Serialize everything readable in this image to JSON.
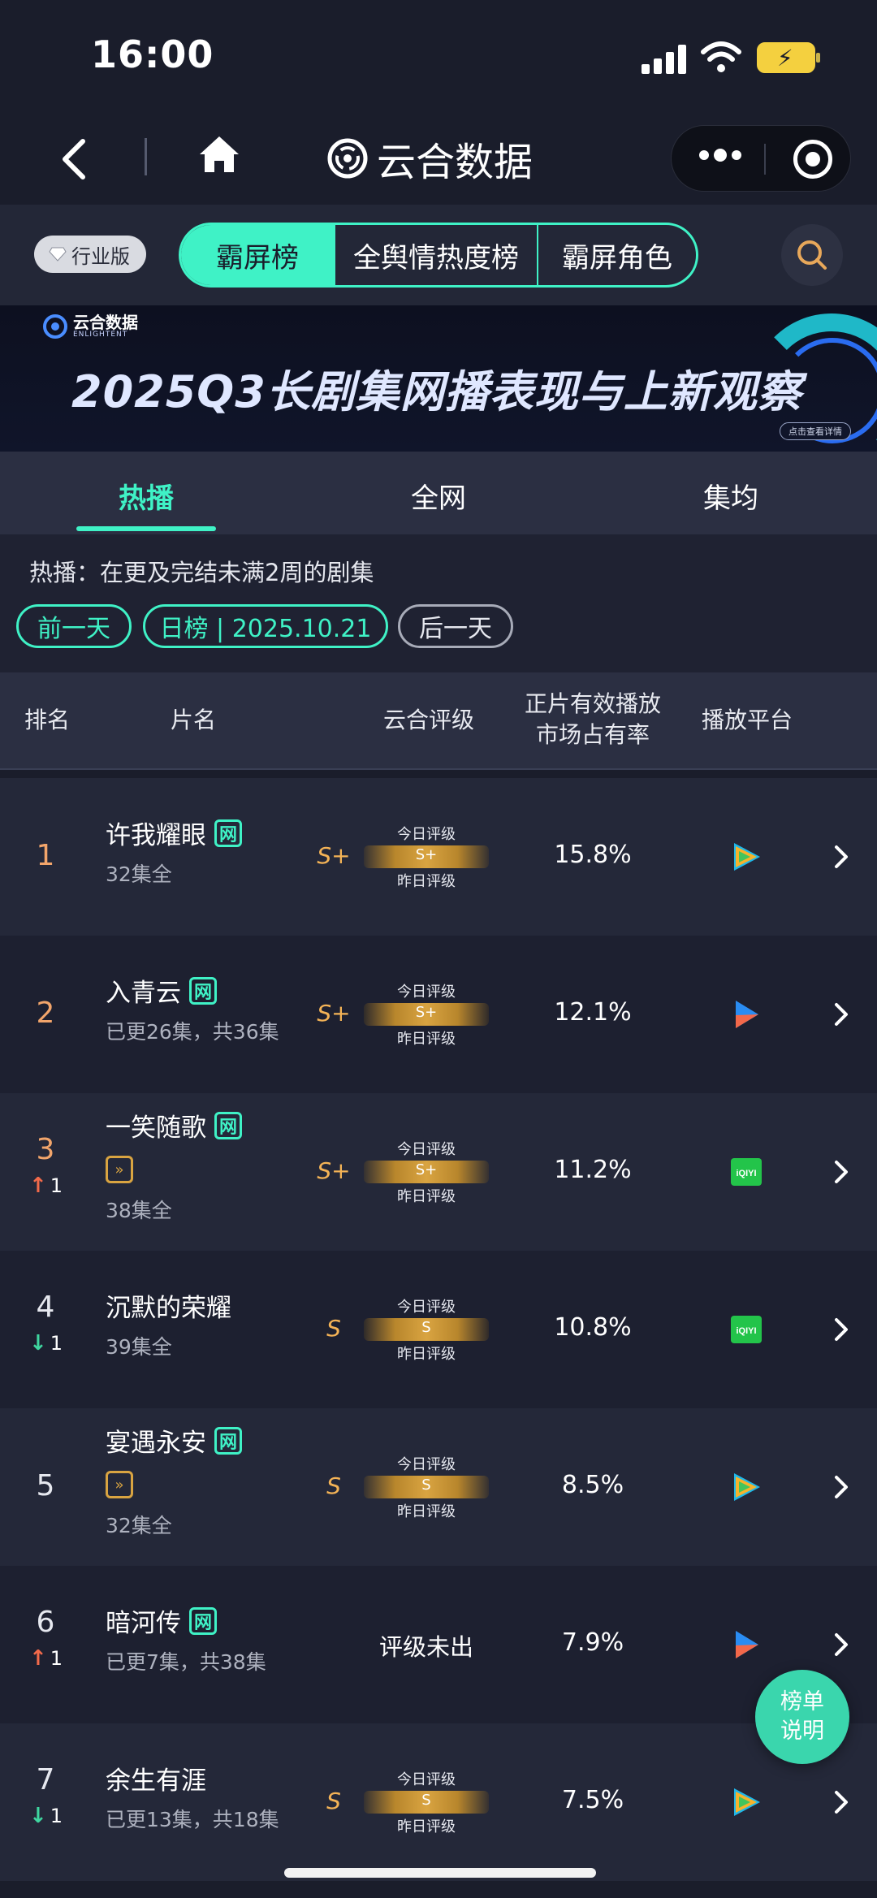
{
  "status": {
    "time": "16:00"
  },
  "nav": {
    "title": "云合数据"
  },
  "switcher": {
    "edition": "行业版",
    "tabs": [
      "霸屏榜",
      "全舆情热度榜",
      "霸屏角色"
    ],
    "active_index": 0
  },
  "banner": {
    "logo_cn": "云合数据",
    "logo_en": "ENLIGHTENT",
    "headline": "2025Q3长剧集网播表现与上新观察",
    "more": "点击查看详情"
  },
  "rank_tabs": [
    "热播",
    "全网",
    "集均"
  ],
  "info": {
    "desc": "热播：在更及完结未满2周的剧集",
    "prev": "前一天",
    "date": "日榜 | 2025.10.21",
    "next": "后一天"
  },
  "table_header": {
    "rank": "排名",
    "title": "片名",
    "grade": "云合评级",
    "share_line1": "正片有效播放",
    "share_line2": "市场占有率",
    "platform": "播放平台"
  },
  "gauge_labels": {
    "today": "今日评级",
    "yesterday": "昨日评级"
  },
  "rows": [
    {
      "rank": "1",
      "name": "许我耀眼",
      "net": "网",
      "ff": false,
      "sub": "32集全",
      "grade": "S+",
      "gauge": "S+",
      "share": "15.8%",
      "platform": "tencent",
      "trend": "",
      "trend_value": ""
    },
    {
      "rank": "2",
      "name": "入青云",
      "net": "网",
      "ff": false,
      "sub": "已更26集，共36集",
      "grade": "S+",
      "gauge": "S+",
      "share": "12.1%",
      "platform": "youku",
      "trend": "",
      "trend_value": ""
    },
    {
      "rank": "3",
      "name": "一笑随歌",
      "net": "网",
      "ff": true,
      "sub": "38集全",
      "grade": "S+",
      "gauge": "S+",
      "share": "11.2%",
      "platform": "iqiyi",
      "trend": "up",
      "trend_value": "1"
    },
    {
      "rank": "4",
      "name": "沉默的荣耀",
      "net": "",
      "ff": false,
      "sub": "39集全",
      "grade": "S",
      "gauge": "S",
      "share": "10.8%",
      "platform": "iqiyi",
      "trend": "down",
      "trend_value": "1"
    },
    {
      "rank": "5",
      "name": "宴遇永安",
      "net": "网",
      "ff": true,
      "sub": "32集全",
      "grade": "S",
      "gauge": "S",
      "share": "8.5%",
      "platform": "tencent",
      "trend": "",
      "trend_value": ""
    },
    {
      "rank": "6",
      "name": "暗河传",
      "net": "网",
      "ff": false,
      "sub": "已更7集，共38集",
      "grade": "",
      "pending": "评级未出",
      "share": "7.9%",
      "platform": "youku",
      "trend": "up",
      "trend_value": "1"
    },
    {
      "rank": "7",
      "name": "余生有涯",
      "net": "",
      "ff": false,
      "sub": "已更13集，共18集",
      "grade": "S",
      "gauge": "S",
      "share": "7.5%",
      "platform": "tencent",
      "trend": "down",
      "trend_value": "1"
    }
  ],
  "platform_icons": {
    "tencent": "tencent-video-icon",
    "youku": "youku-icon",
    "iqiyi": "iqiyi-icon"
  },
  "float_button": {
    "line1": "榜单",
    "line2": "说明"
  },
  "colors": {
    "accent": "#3ff2c6",
    "rank_top": "#f2a56b",
    "grade": "#f4b356",
    "bg": "#1a1d2b"
  }
}
